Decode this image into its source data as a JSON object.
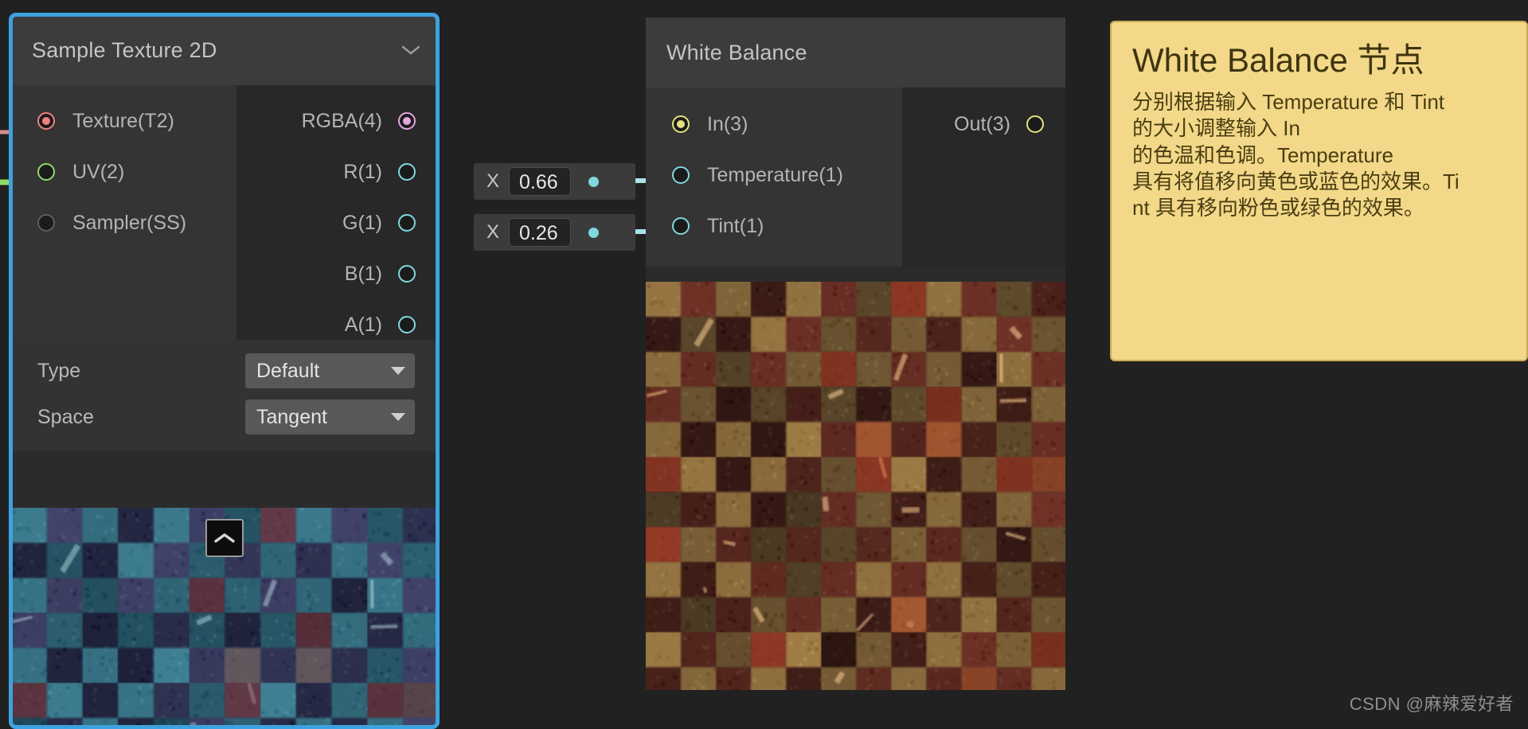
{
  "canvas": {
    "background": "#212121",
    "selection_color": "#3da2e0"
  },
  "nodes": [
    {
      "id": "sample-texture-2d",
      "title": "Sample Texture 2D",
      "selected": true,
      "collapse_icon": "chevron-down-icon",
      "inputs": [
        {
          "label": "Texture(T2)",
          "type": "Texture2D",
          "color": "#f08080",
          "connected": true
        },
        {
          "label": "UV(2)",
          "type": "Vector2",
          "color": "#8fd96a",
          "connected": true
        },
        {
          "label": "Sampler(SS)",
          "type": "SamplerState",
          "color": "#5d5d5d",
          "connected": false
        }
      ],
      "outputs": [
        {
          "label": "RGBA(4)",
          "type": "Vector4",
          "color": "#e4a5e0",
          "connected": true
        },
        {
          "label": "R(1)",
          "type": "Float",
          "color": "#7fd8de",
          "connected": false
        },
        {
          "label": "G(1)",
          "type": "Float",
          "color": "#7fd8de",
          "connected": false
        },
        {
          "label": "B(1)",
          "type": "Float",
          "color": "#7fd8de",
          "connected": false
        },
        {
          "label": "A(1)",
          "type": "Float",
          "color": "#7fd8de",
          "connected": false
        }
      ],
      "controls": [
        {
          "label": "Type",
          "value": "Default",
          "control": "dropdown"
        },
        {
          "label": "Space",
          "value": "Tangent",
          "control": "dropdown"
        }
      ],
      "preview": {
        "name": "node-preview-sample-texture",
        "tint": "cool-blue-teal",
        "collapse_icon": "chevron-up-icon"
      }
    },
    {
      "id": "white-balance",
      "title": "White Balance",
      "selected": false,
      "inputs": [
        {
          "label": "In(3)",
          "type": "Vector3",
          "color": "#e3e17d",
          "connected": true
        },
        {
          "label": "Temperature(1)",
          "type": "Float",
          "color": "#7fd8de",
          "connected": true
        },
        {
          "label": "Tint(1)",
          "type": "Float",
          "color": "#7fd8de",
          "connected": true
        }
      ],
      "outputs": [
        {
          "label": "Out(3)",
          "type": "Vector3",
          "color": "#e3e17d",
          "connected": false
        }
      ],
      "controls": [],
      "preview": {
        "name": "node-preview-white-balance",
        "tint": "warm-orange"
      }
    }
  ],
  "inline_inputs": [
    {
      "id": "temperature-value",
      "axis": "X",
      "value": "0.66",
      "target": "Temperature(1)"
    },
    {
      "id": "tint-value",
      "axis": "X",
      "value": "0.26",
      "target": "Tint(1)"
    }
  ],
  "edges": [
    {
      "from": "RGBA(4)",
      "to": "In(3)",
      "from_color": "#e4a5e0",
      "to_color": "#e3e17d"
    },
    {
      "from": "temperature-value",
      "to": "Temperature(1)",
      "color": "#a9e3e8"
    },
    {
      "from": "tint-value",
      "to": "Tint(1)",
      "color": "#a9e3e8"
    }
  ],
  "sticky_note": {
    "title": "White Balance 节点",
    "body": "分别根据输入 Temperature 和 Tint\n的大小调整输入 In\n的色温和色调。Temperature\n具有将值移向黄色或蓝色的效果。Ti\nnt 具有移向粉色或绿色的效果。",
    "background": "#f2d888",
    "text_color": "#4a3d12"
  },
  "watermark": {
    "text": "CSDN @麻辣爱好者"
  }
}
